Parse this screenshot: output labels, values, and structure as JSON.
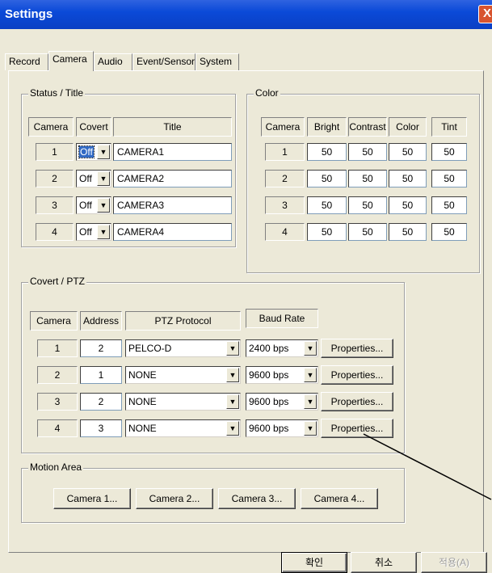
{
  "window": {
    "title": "Settings",
    "close": "X"
  },
  "tabs": [
    "Record",
    "Camera",
    "Audio",
    "Event/Sensor",
    "System"
  ],
  "status_title": {
    "legend": "Status / Title",
    "headers": {
      "camera": "Camera",
      "covert": "Covert",
      "title": "Title"
    },
    "rows": [
      {
        "camera": "1",
        "covert": "Off",
        "title": "CAMERA1"
      },
      {
        "camera": "2",
        "covert": "Off",
        "title": "CAMERA2"
      },
      {
        "camera": "3",
        "covert": "Off",
        "title": "CAMERA3"
      },
      {
        "camera": "4",
        "covert": "Off",
        "title": "CAMERA4"
      }
    ]
  },
  "color": {
    "legend": "Color",
    "headers": {
      "camera": "Camera",
      "bright": "Bright",
      "contrast": "Contrast",
      "color": "Color",
      "tint": "Tint"
    },
    "rows": [
      {
        "camera": "1",
        "bright": "50",
        "contrast": "50",
        "color": "50",
        "tint": "50"
      },
      {
        "camera": "2",
        "bright": "50",
        "contrast": "50",
        "color": "50",
        "tint": "50"
      },
      {
        "camera": "3",
        "bright": "50",
        "contrast": "50",
        "color": "50",
        "tint": "50"
      },
      {
        "camera": "4",
        "bright": "50",
        "contrast": "50",
        "color": "50",
        "tint": "50"
      }
    ]
  },
  "covert_ptz": {
    "legend": "Covert / PTZ",
    "headers": {
      "camera": "Camera",
      "address": "Address",
      "protocol": "PTZ Protocol",
      "baud": "Baud Rate"
    },
    "properties_label": "Properties...",
    "rows": [
      {
        "camera": "1",
        "address": "2",
        "protocol": "PELCO-D",
        "baud": "2400 bps"
      },
      {
        "camera": "2",
        "address": "1",
        "protocol": "NONE",
        "baud": "9600 bps"
      },
      {
        "camera": "3",
        "address": "2",
        "protocol": "NONE",
        "baud": "9600 bps"
      },
      {
        "camera": "4",
        "address": "3",
        "protocol": "NONE",
        "baud": "9600 bps"
      }
    ]
  },
  "motion_area": {
    "legend": "Motion Area",
    "buttons": [
      "Camera 1...",
      "Camera 2...",
      "Camera 3...",
      "Camera 4..."
    ]
  },
  "footer": {
    "ok": "확인",
    "cancel": "취소",
    "apply": "적용(A)"
  },
  "icons": {
    "dropdown": "chevron-down-icon"
  }
}
